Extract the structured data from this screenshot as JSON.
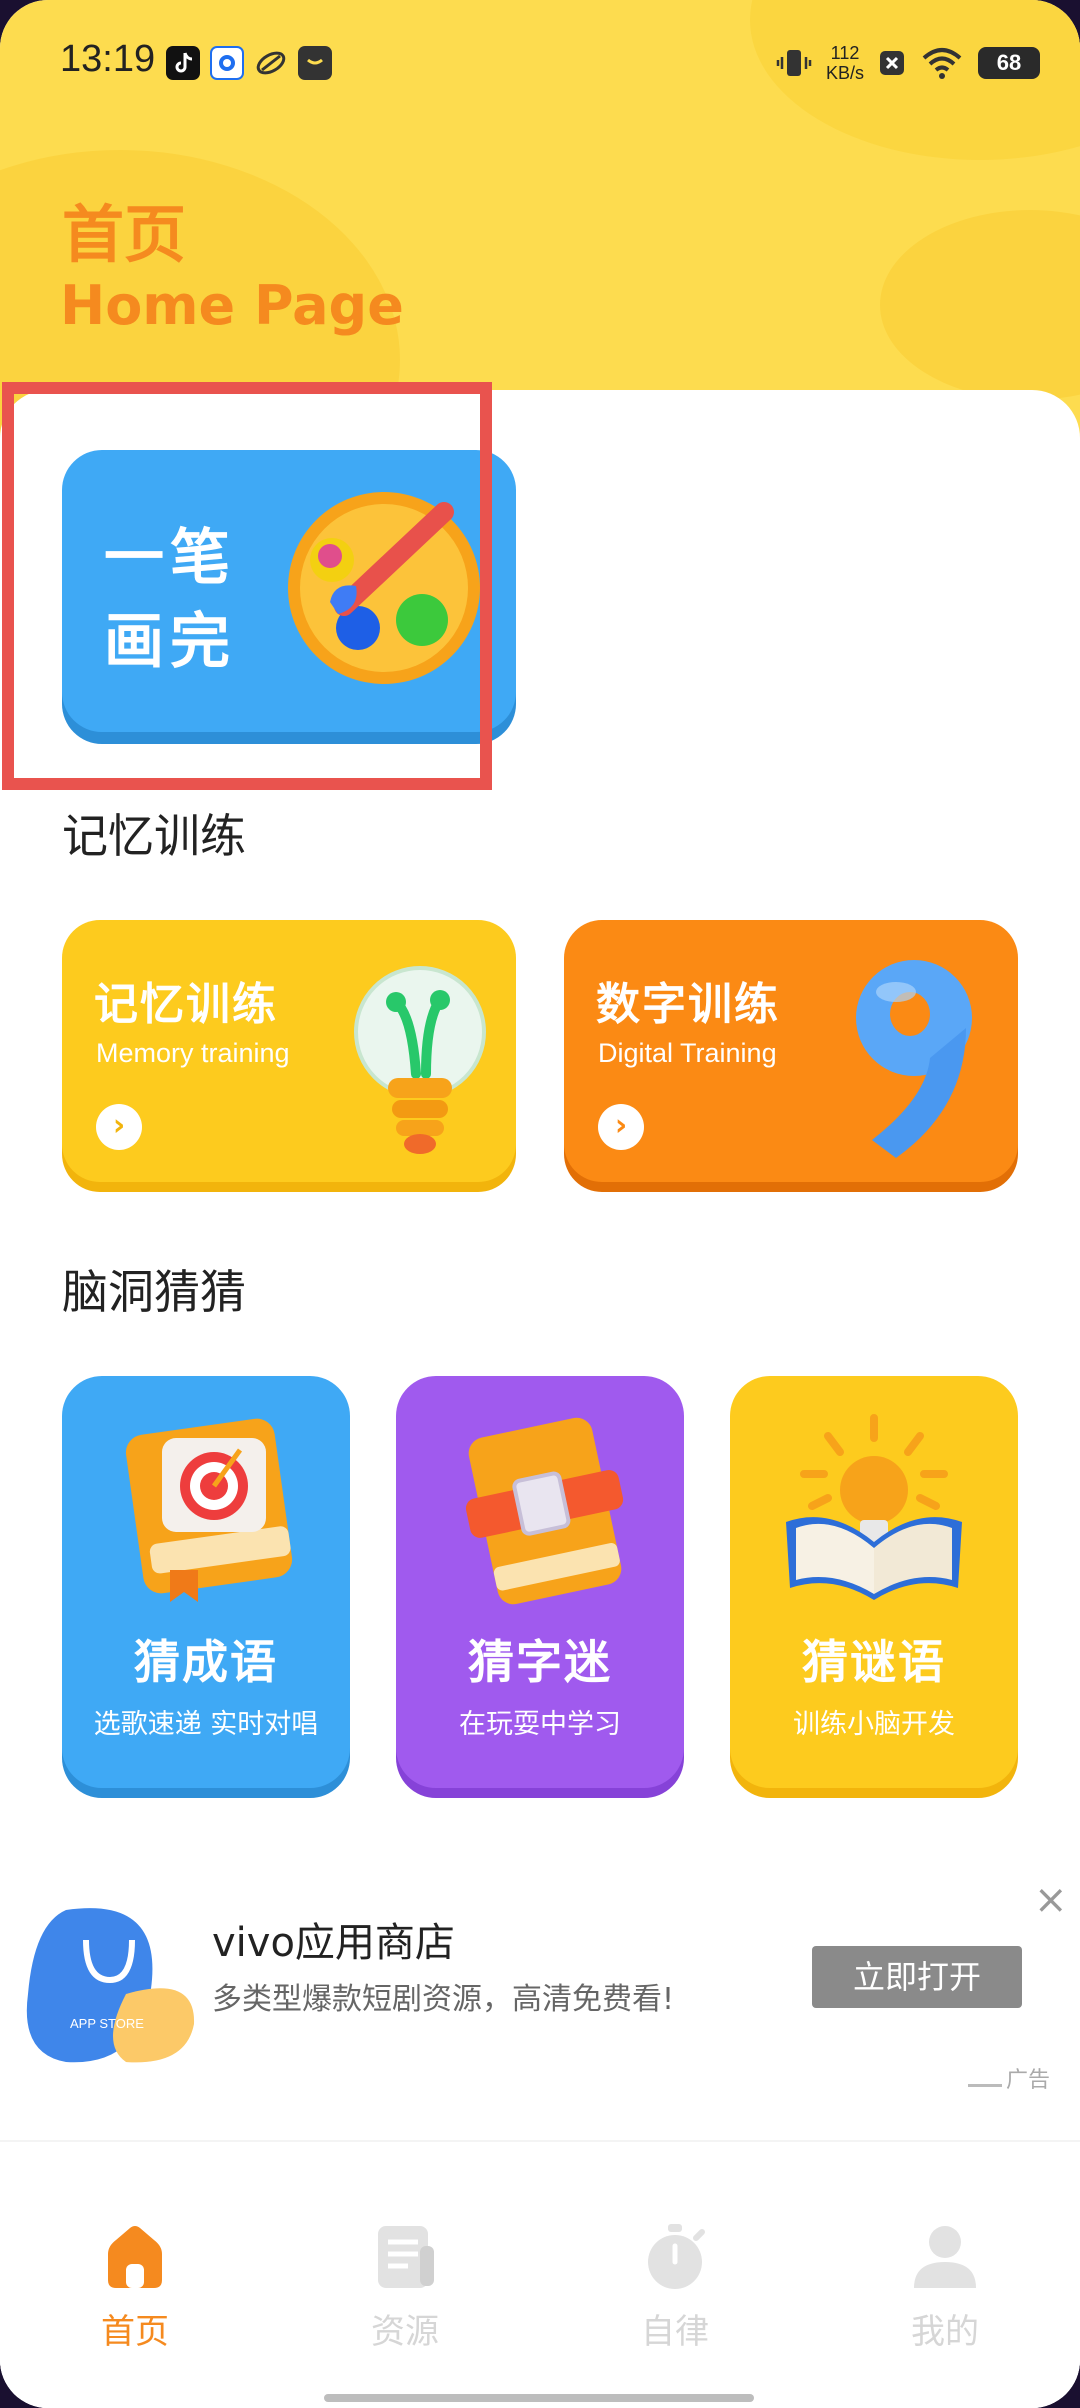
{
  "status_bar": {
    "time": "13:19",
    "net_speed_value": "112",
    "net_speed_unit": "KB/s",
    "battery": "68"
  },
  "header": {
    "title": "首页",
    "subtitle": "Home Page"
  },
  "featured_card": {
    "label": "一笔画完",
    "icon": "paint-palette-icon"
  },
  "memory_section": {
    "title": "记忆训练",
    "cards": [
      {
        "title": "记忆训练",
        "subtitle": "Memory training",
        "icon": "lightbulb-icon",
        "color": "#fdcb1e"
      },
      {
        "title": "数字训练",
        "subtitle": "Digital Training",
        "icon": "number-nine-icon",
        "color": "#fb8a14"
      }
    ]
  },
  "brain_section": {
    "title": "脑洞猜猜",
    "cards": [
      {
        "title": "猜成语",
        "subtitle": "选歌速递 实时对唱",
        "icon": "target-book-icon",
        "color": "#3fa9f5"
      },
      {
        "title": "猜字迷",
        "subtitle": "在玩耍中学习",
        "icon": "closed-book-icon",
        "color": "#a05aee"
      },
      {
        "title": "猜谜语",
        "subtitle": "训练小脑开发",
        "icon": "open-book-bulb-icon",
        "color": "#fdcb1e"
      }
    ]
  },
  "ad": {
    "app_name": "vivo应用商店",
    "description": "多类型爆款短剧资源，高清免费看!",
    "button": "立即打开",
    "logo_text": "APP STORE",
    "label": "广告"
  },
  "bottom_nav": {
    "items": [
      {
        "label": "首页",
        "icon": "home-icon",
        "active": true
      },
      {
        "label": "资源",
        "icon": "document-icon",
        "active": false
      },
      {
        "label": "自律",
        "icon": "stopwatch-icon",
        "active": false
      },
      {
        "label": "我的",
        "icon": "person-icon",
        "active": false
      }
    ],
    "active_color": "#f58a1f",
    "inactive_color": "#d6d6d6"
  }
}
